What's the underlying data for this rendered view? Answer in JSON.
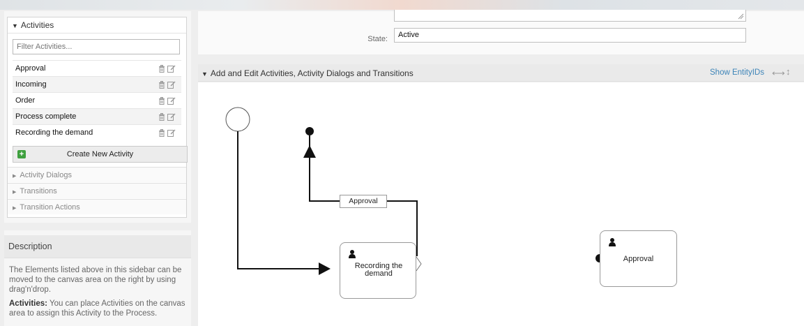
{
  "sidebar": {
    "activities_header": "Activities",
    "filter_placeholder": "Filter Activities...",
    "activities": [
      {
        "label": "Approval"
      },
      {
        "label": "Incoming"
      },
      {
        "label": "Order"
      },
      {
        "label": "Process complete"
      },
      {
        "label": "Recording the demand"
      }
    ],
    "create_button": "Create New Activity",
    "sections": [
      "Activity Dialogs",
      "Transitions",
      "Transition Actions"
    ]
  },
  "description": {
    "title": "Description",
    "para1": "The Elements listed above in this sidebar can be moved to the canvas area on the right by using drag'n'drop.",
    "para2_bold": "Activities:",
    "para2": " You can place Activities on the canvas area to assign this Activity to the Process."
  },
  "form": {
    "state_label": "State:",
    "state_value": "Active"
  },
  "canvas": {
    "title": "Add and Edit Activities, Activity Dialogs and Transitions",
    "show_entity_ids": "Show EntityIDs",
    "activity_recording": "Recording the demand",
    "activity_approval": "Approval",
    "transition_label": "Approval"
  },
  "colors": {
    "link": "#3d84b8",
    "create_icon": "#3fa03f"
  }
}
